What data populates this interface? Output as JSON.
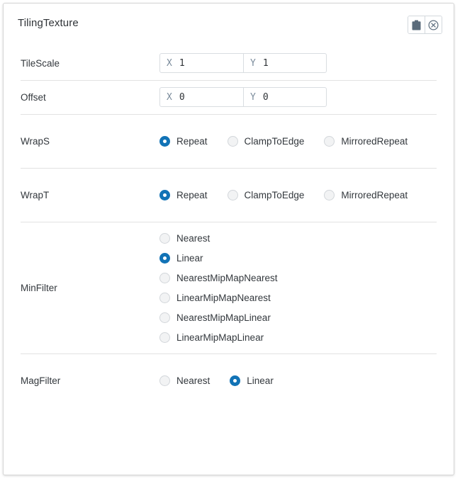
{
  "panel": {
    "title": "TilingTexture",
    "actions": [
      {
        "name": "paste-button",
        "icon": "clipboard-icon",
        "label": "Paste"
      },
      {
        "name": "clear-button",
        "icon": "circle-x-icon",
        "label": "Clear"
      }
    ]
  },
  "colors": {
    "accent": "#1273b6",
    "panel_border": "#d6d6d6",
    "separator": "#e2e2e2",
    "input_border": "#d9dde1",
    "axis_label": "#7b8c9c",
    "text": "#33383d",
    "radio_unchecked_fill": "#f2f3f4",
    "radio_unchecked_border": "#d2d6da"
  },
  "fields": {
    "tilescale": {
      "label": "TileScale",
      "x": {
        "axis": "X",
        "value": "1",
        "placeholder": ""
      },
      "y": {
        "axis": "Y",
        "value": "1",
        "placeholder": ""
      }
    },
    "offset": {
      "label": "Offset",
      "x": {
        "axis": "X",
        "value": "0",
        "placeholder": ""
      },
      "y": {
        "axis": "Y",
        "value": "0",
        "placeholder": ""
      }
    },
    "wraps": {
      "label": "WrapS",
      "options": [
        "Repeat",
        "ClampToEdge",
        "MirroredRepeat"
      ],
      "selected": "Repeat"
    },
    "wrapt": {
      "label": "WrapT",
      "options": [
        "Repeat",
        "ClampToEdge",
        "MirroredRepeat"
      ],
      "selected": "Repeat"
    },
    "minfilter": {
      "label": "MinFilter",
      "options": [
        "Nearest",
        "Linear",
        "NearestMipMapNearest",
        "LinearMipMapNearest",
        "NearestMipMapLinear",
        "LinearMipMapLinear"
      ],
      "selected": "Linear"
    },
    "magfilter": {
      "label": "MagFilter",
      "options": [
        "Nearest",
        "Linear"
      ],
      "selected": "Linear"
    }
  }
}
